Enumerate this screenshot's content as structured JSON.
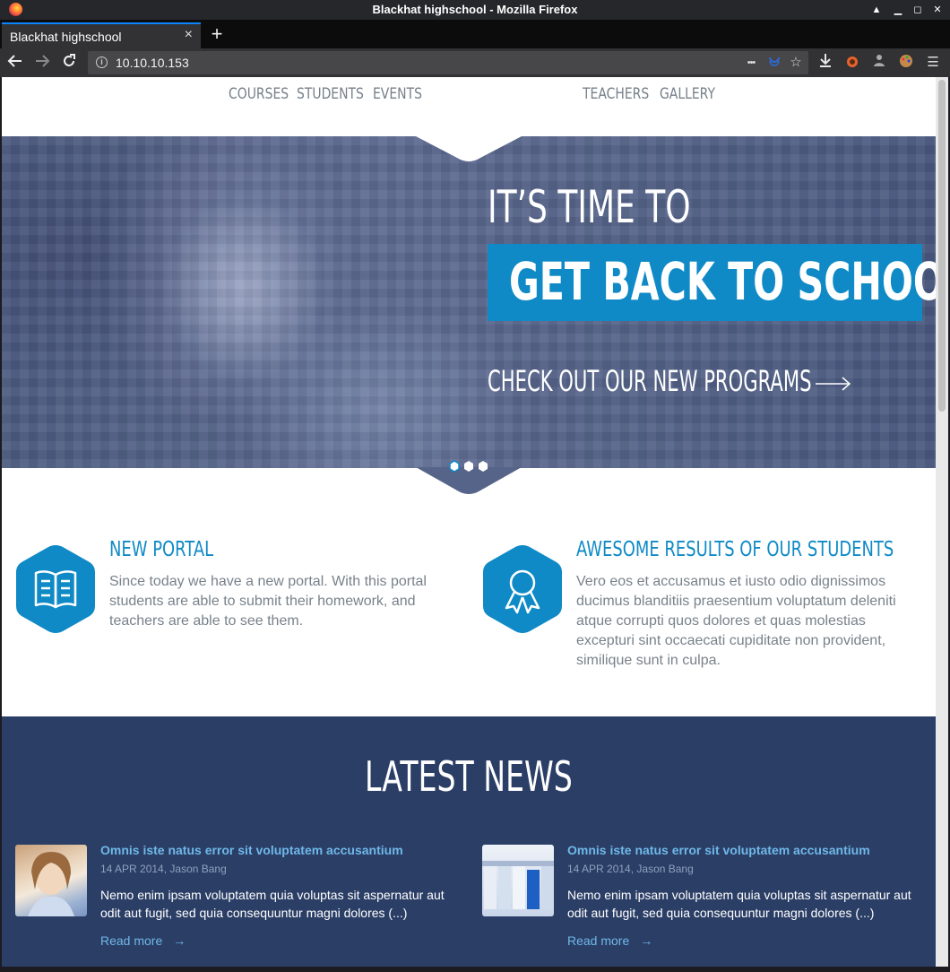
{
  "window": {
    "title": "Blackhat highschool - Mozilla Firefox"
  },
  "browser": {
    "tab_title": "Blackhat highschool",
    "tab_close": "×",
    "new_tab": "+",
    "url": "10.10.10.153",
    "more_dots": "•••"
  },
  "site_nav": [
    "COURSES",
    "STUDENTS",
    "EVENTS",
    "TEACHERS",
    "GALLERY"
  ],
  "hero": {
    "line1": "IT’S TIME TO",
    "highlight": "GET BACK TO SCHOOL",
    "cta": "CHECK OUT OUR NEW PROGRAMS",
    "slide_count": 3,
    "active_slide": 1
  },
  "features": [
    {
      "icon": "open-book-icon",
      "title": "NEW PORTAL",
      "lines": [
        "Since today we have a new portal. With this portal",
        "students are able to submit their homework, and",
        "teachers are able to see them."
      ]
    },
    {
      "icon": "award-ribbon-icon",
      "title": "AWESOME RESULTS OF OUR STUDENTS",
      "lines": [
        "Vero eos et accusamus et iusto odio dignissimos",
        "ducimus blanditiis praesentium voluptatum deleniti",
        "atque corrupti quos dolores et quas molestias",
        "excepturi sint occaecati cupiditate non provident,",
        "similique sunt in culpa."
      ]
    }
  ],
  "news": {
    "title": "LATEST NEWS",
    "items": [
      {
        "headline": "Omnis iste natus error sit voluptatem accusantium",
        "meta": "14 APR 2014, Jason Bang",
        "body_lines": [
          "Nemo enim ipsam voluptatem quia voluptas sit aspernatur aut",
          "odit aut fugit, sed quia consequuntur magni dolores (...)"
        ],
        "read_more": "Read more"
      },
      {
        "headline": "Omnis iste natus error sit voluptatem accusantium",
        "meta": "14 APR 2014, Jason Bang",
        "body_lines": [
          "Nemo enim ipsam voluptatem quia voluptas sit aspernatur aut",
          "odit aut fugit, sed quia consequuntur magni dolores (...)"
        ],
        "read_more": "Read more"
      }
    ]
  },
  "colors": {
    "accent": "#0f8ac6",
    "news_bg": "#2b3e66",
    "link": "#6fb8e8",
    "hero_bg": "#56648a"
  }
}
